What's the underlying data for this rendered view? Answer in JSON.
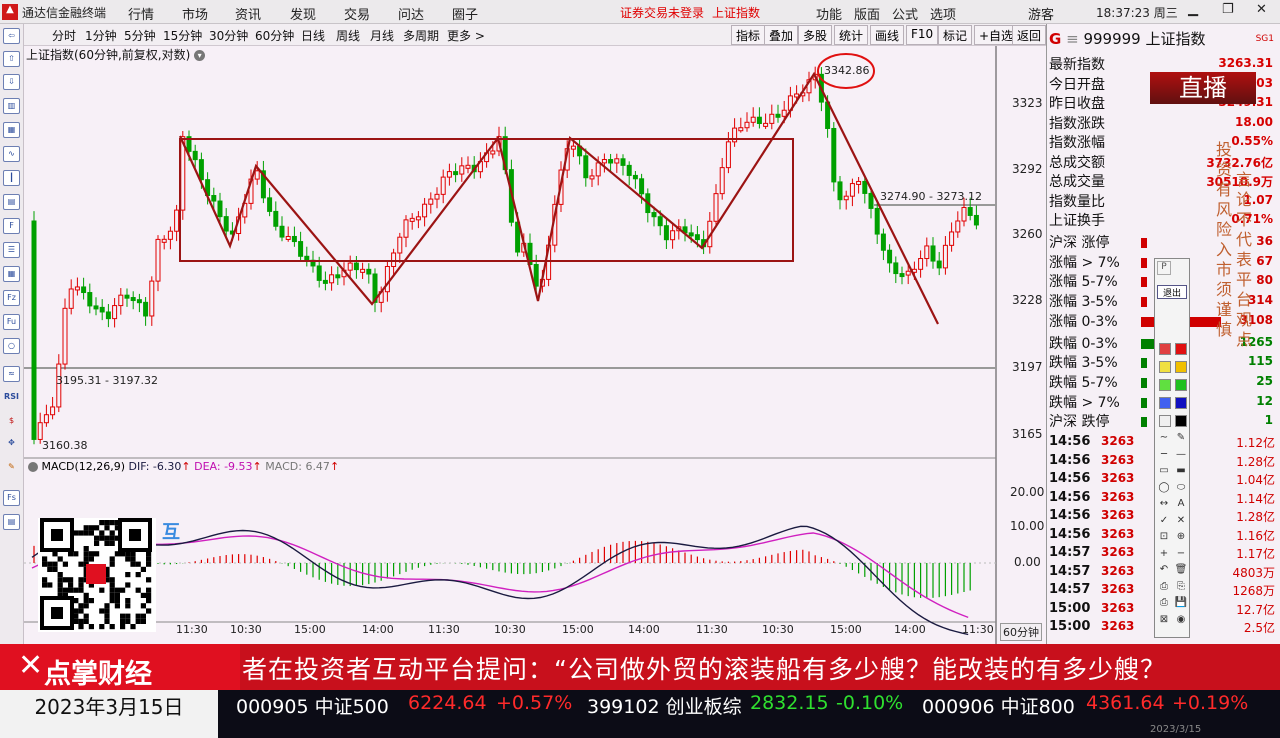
{
  "menubar": {
    "app_title": "通达信金融终端",
    "items": [
      "行情",
      "市场",
      "资讯",
      "发现",
      "交易",
      "问达",
      "圈子"
    ],
    "notice": "证券交易未登录",
    "index_link": "上证指数",
    "right_items": [
      "功能",
      "版面",
      "公式",
      "选项"
    ],
    "user": "游客",
    "clock": "18:37:23 周三"
  },
  "toolbar": {
    "periods": [
      "分时",
      "1分钟",
      "5分钟",
      "15分钟",
      "30分钟",
      "60分钟",
      "日线",
      "周线",
      "月线",
      "多周期",
      "更多 >"
    ],
    "active_period": "60分钟",
    "right_buttons": [
      "指标",
      "叠加",
      "多股",
      "统计",
      "画线",
      "F10",
      "标记",
      "+自选",
      "返回"
    ]
  },
  "chart": {
    "header": "上证指数(60分钟,前复权,对数)",
    "y_ticks": [
      "3323",
      "3292",
      "3260",
      "3228",
      "3197",
      "3165"
    ],
    "annotations": {
      "high": "3342.86",
      "low": "3160.38",
      "level_low": "3195.31 - 3197.32",
      "level_high": "3274.90 - 3273.12"
    },
    "macd_header": "MACD(12,26,9)",
    "dif": "DIF: -6.30",
    "dea": "DEA: -9.53",
    "macd": "MACD: 6.47",
    "macd_ticks": [
      "20.00",
      "10.00",
      "0.00"
    ],
    "x_ticks": [
      "11:30",
      "10:30",
      "15:00",
      "14:00",
      "11:30",
      "10:30",
      "15:00",
      "14:00",
      "11:30",
      "10:30",
      "15:00",
      "14:00",
      "11:30"
    ],
    "period_badge": "60分钟"
  },
  "quote": {
    "code": "999999",
    "name": "上证指数",
    "badge": "SG1",
    "rows": [
      {
        "label": "最新指数",
        "value": "3263.31"
      },
      {
        "label": "今日开盘",
        "value": ".03"
      },
      {
        "label": "昨日收盘",
        "value": "3249.31"
      },
      {
        "label": "指数涨跌",
        "value": "18.00"
      },
      {
        "label": "指数涨幅",
        "value": "0.55%"
      },
      {
        "label": "总成交额",
        "value": "3732.76亿"
      },
      {
        "label": "总成交量",
        "value": "30510.9万"
      },
      {
        "label": "指数量比",
        "value": "1.07"
      },
      {
        "label": "上证换手",
        "value": "0.71%"
      }
    ],
    "breadth": [
      {
        "label": "沪深 涨停",
        "value": "36",
        "color": "#d00000"
      },
      {
        "label": "涨幅 > 7%",
        "value": "67",
        "color": "#d00000"
      },
      {
        "label": "涨幅 5-7%",
        "value": "80",
        "color": "#d00000"
      },
      {
        "label": "涨幅 3-5%",
        "value": "314",
        "color": "#d00000"
      },
      {
        "label": "涨幅 0-3%",
        "value": "3108",
        "color": "#d00000"
      },
      {
        "label": "跌幅 0-3%",
        "value": "1265",
        "color": "#008000"
      },
      {
        "label": "跌幅 3-5%",
        "value": "115",
        "color": "#008000"
      },
      {
        "label": "跌幅 5-7%",
        "value": "25",
        "color": "#008000"
      },
      {
        "label": "跌幅 > 7%",
        "value": "12",
        "color": "#008000"
      },
      {
        "label": "沪深 跌停",
        "value": "1",
        "color": "#008000"
      }
    ],
    "ticks": [
      {
        "time": "14:56",
        "price": "3263",
        "amount": "1.12亿"
      },
      {
        "time": "14:56",
        "price": "3263",
        "amount": "1.28亿"
      },
      {
        "time": "14:56",
        "price": "3263",
        "amount": "1.04亿"
      },
      {
        "time": "14:56",
        "price": "3263",
        "amount": "1.14亿"
      },
      {
        "time": "14:56",
        "price": "3263",
        "amount": "1.28亿"
      },
      {
        "time": "14:56",
        "price": "3263",
        "amount": "1.16亿"
      },
      {
        "time": "14:57",
        "price": "3263",
        "amount": "1.17亿"
      },
      {
        "time": "14:57",
        "price": "3263",
        "amount": "4803万"
      },
      {
        "time": "14:57",
        "price": "3263",
        "amount": "1268万"
      },
      {
        "time": "15:00",
        "price": "3263",
        "amount": "12.7亿"
      },
      {
        "time": "15:00",
        "price": "3263",
        "amount": "2.5亿"
      }
    ],
    "overlay_live": "直播",
    "overlay_disclaimer_a": "投资有风险入市须谨慎",
    "overlay_disclaimer_b": "言论不代表平台观点",
    "tool_exit": "退出",
    "tool_p": "P"
  },
  "broadcast": {
    "logo": "点掌财经",
    "scroll": "者在投资者互动平台提问：“公司做外贸的滚装船有多少艘？能改装的有多少艘？",
    "date": "2023年3月15日",
    "tickers": [
      {
        "code": "000905 中证500",
        "price": "6224.64",
        "chg": "+0.57%",
        "color": "#ff2a2a"
      },
      {
        "code": "399102 创业板综",
        "price": "2832.15",
        "chg": "-0.10%",
        "color": "#2fe02f"
      },
      {
        "code": "000906 中证800",
        "price": "4361.64",
        "chg": "+0.19%",
        "color": "#ff2a2a"
      }
    ],
    "corner_date": "2023/3/15"
  },
  "colors": {
    "up": "#e00000",
    "down": "#00a000",
    "box": "#9c1414",
    "dif": "#1a1a40",
    "dea": "#d020c0"
  }
}
